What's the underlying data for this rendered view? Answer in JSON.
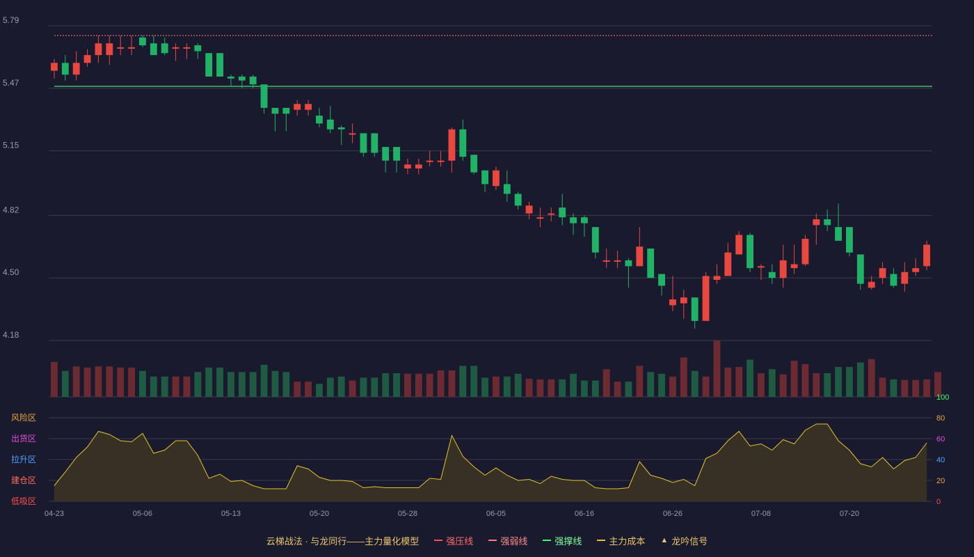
{
  "colors": {
    "background": "#1a1a2e",
    "up": "#e8483f",
    "down": "#20b267",
    "up_volume": "#6b2b30",
    "down_volume": "#1f5a43",
    "grid": "#3a3a4e",
    "axis_text": "#9a9aa8",
    "resistance": "#ff7a7a",
    "support": "#3dbf6a",
    "indicator": "#e8c228",
    "indicator_fill": "#3b3425"
  },
  "chart_data": {
    "type": "candlestick",
    "price_axis": {
      "ticks": [
        "5.79",
        "5.47",
        "5.15",
        "4.82",
        "4.50",
        "4.18"
      ],
      "ylim": [
        4.18,
        5.79
      ]
    },
    "x_ticks": [
      "04-23",
      "05-06",
      "05-13",
      "05-20",
      "05-28",
      "06-05",
      "06-16",
      "06-26",
      "07-08",
      "07-20"
    ],
    "x_tick_indices": [
      0,
      8,
      16,
      24,
      32,
      40,
      48,
      56,
      64,
      72
    ],
    "resistance_line": 5.74,
    "support_line": 5.48,
    "candles": [
      [
        5.56,
        5.6,
        5.62,
        5.52
      ],
      [
        5.6,
        5.54,
        5.64,
        5.51
      ],
      [
        5.54,
        5.6,
        5.66,
        5.51
      ],
      [
        5.6,
        5.64,
        5.67,
        5.58
      ],
      [
        5.64,
        5.7,
        5.74,
        5.6
      ],
      [
        5.64,
        5.7,
        5.74,
        5.59
      ],
      [
        5.68,
        5.68,
        5.74,
        5.64
      ],
      [
        5.68,
        5.68,
        5.74,
        5.64
      ],
      [
        5.73,
        5.69,
        5.74,
        5.68
      ],
      [
        5.7,
        5.64,
        5.74,
        5.64
      ],
      [
        5.7,
        5.65,
        5.73,
        5.64
      ],
      [
        5.68,
        5.68,
        5.7,
        5.61
      ],
      [
        5.68,
        5.68,
        5.7,
        5.62
      ],
      [
        5.69,
        5.66,
        5.7,
        5.62
      ],
      [
        5.65,
        5.53,
        5.65,
        5.53
      ],
      [
        5.65,
        5.53,
        5.65,
        5.53
      ],
      [
        5.53,
        5.52,
        5.54,
        5.48
      ],
      [
        5.53,
        5.51,
        5.54,
        5.47
      ],
      [
        5.53,
        5.49,
        5.54,
        5.47
      ],
      [
        5.49,
        5.37,
        5.49,
        5.34
      ],
      [
        5.37,
        5.34,
        5.37,
        5.25
      ],
      [
        5.37,
        5.34,
        5.37,
        5.25
      ],
      [
        5.36,
        5.39,
        5.41,
        5.33
      ],
      [
        5.36,
        5.39,
        5.41,
        5.33
      ],
      [
        5.33,
        5.29,
        5.37,
        5.27
      ],
      [
        5.31,
        5.26,
        5.38,
        5.24
      ],
      [
        5.27,
        5.26,
        5.28,
        5.18
      ],
      [
        5.24,
        5.24,
        5.29,
        5.19
      ],
      [
        5.24,
        5.14,
        5.24,
        5.12
      ],
      [
        5.24,
        5.14,
        5.24,
        5.12
      ],
      [
        5.17,
        5.1,
        5.17,
        5.04
      ],
      [
        5.17,
        5.1,
        5.17,
        5.04
      ],
      [
        5.06,
        5.08,
        5.11,
        5.03
      ],
      [
        5.06,
        5.08,
        5.11,
        5.03
      ],
      [
        5.1,
        5.1,
        5.15,
        5.07
      ],
      [
        5.1,
        5.1,
        5.15,
        5.07
      ],
      [
        5.1,
        5.26,
        5.27,
        5.04
      ],
      [
        5.26,
        5.12,
        5.31,
        5.1
      ],
      [
        5.13,
        5.04,
        5.13,
        5.03
      ],
      [
        5.05,
        4.98,
        5.05,
        4.94
      ],
      [
        4.97,
        5.05,
        5.07,
        4.95
      ],
      [
        4.98,
        4.93,
        5.05,
        4.89
      ],
      [
        4.93,
        4.87,
        4.94,
        4.85
      ],
      [
        4.83,
        4.87,
        4.89,
        4.8
      ],
      [
        4.81,
        4.81,
        4.86,
        4.76
      ],
      [
        4.83,
        4.83,
        4.86,
        4.79
      ],
      [
        4.86,
        4.81,
        4.93,
        4.77
      ],
      [
        4.81,
        4.78,
        4.83,
        4.72
      ],
      [
        4.81,
        4.78,
        4.82,
        4.71
      ],
      [
        4.76,
        4.63,
        4.76,
        4.6
      ],
      [
        4.59,
        4.59,
        4.65,
        4.55
      ],
      [
        4.59,
        4.59,
        4.64,
        4.55
      ],
      [
        4.59,
        4.56,
        4.6,
        4.45
      ],
      [
        4.56,
        4.66,
        4.76,
        4.56
      ],
      [
        4.65,
        4.5,
        4.65,
        4.5
      ],
      [
        4.52,
        4.46,
        4.52,
        4.41
      ],
      [
        4.36,
        4.39,
        4.51,
        4.33
      ],
      [
        4.37,
        4.4,
        4.44,
        4.29
      ],
      [
        4.4,
        4.28,
        4.4,
        4.24
      ],
      [
        4.28,
        4.51,
        4.53,
        4.28
      ],
      [
        4.49,
        4.51,
        4.57,
        4.47
      ],
      [
        4.51,
        4.63,
        4.68,
        4.51
      ],
      [
        4.62,
        4.72,
        4.74,
        4.62
      ],
      [
        4.72,
        4.55,
        4.73,
        4.53
      ],
      [
        4.56,
        4.56,
        4.57,
        4.49
      ],
      [
        4.53,
        4.5,
        4.57,
        4.47
      ],
      [
        4.5,
        4.59,
        4.67,
        4.45
      ],
      [
        4.55,
        4.57,
        4.67,
        4.52
      ],
      [
        4.57,
        4.7,
        4.72,
        4.56
      ],
      [
        4.77,
        4.8,
        4.83,
        4.67
      ],
      [
        4.8,
        4.77,
        4.85,
        4.74
      ],
      [
        4.76,
        4.69,
        4.88,
        4.69
      ],
      [
        4.76,
        4.63,
        4.76,
        4.61
      ],
      [
        4.62,
        4.47,
        4.62,
        4.44
      ],
      [
        4.45,
        4.48,
        4.51,
        4.44
      ],
      [
        4.5,
        4.55,
        4.58,
        4.47
      ],
      [
        4.52,
        4.46,
        4.55,
        4.45
      ],
      [
        4.47,
        4.53,
        4.58,
        4.43
      ],
      [
        4.53,
        4.55,
        4.6,
        4.51
      ],
      [
        4.56,
        4.67,
        4.69,
        4.54
      ]
    ],
    "volume_heights": [
      0.62,
      0.46,
      0.54,
      0.52,
      0.54,
      0.54,
      0.52,
      0.52,
      0.46,
      0.36,
      0.36,
      0.36,
      0.36,
      0.44,
      0.52,
      0.52,
      0.44,
      0.44,
      0.44,
      0.57,
      0.46,
      0.44,
      0.27,
      0.27,
      0.23,
      0.34,
      0.36,
      0.29,
      0.34,
      0.34,
      0.42,
      0.42,
      0.41,
      0.41,
      0.41,
      0.47,
      0.47,
      0.55,
      0.55,
      0.34,
      0.36,
      0.36,
      0.41,
      0.32,
      0.31,
      0.31,
      0.31,
      0.41,
      0.29,
      0.29,
      0.49,
      0.27,
      0.27,
      0.55,
      0.44,
      0.41,
      0.36,
      0.7,
      0.46,
      0.36,
      1.0,
      0.52,
      0.53,
      0.66,
      0.42,
      0.49,
      0.4,
      0.64,
      0.58,
      0.42,
      0.42,
      0.53,
      0.53,
      0.61,
      0.67,
      0.34,
      0.31,
      0.3,
      0.3,
      0.31,
      0.44
    ],
    "indicator": {
      "axis_values": [
        "0",
        "20",
        "40",
        "60",
        "80",
        "100"
      ],
      "axis_colors": [
        "#ff4d4d",
        "#ff9c3a",
        "#4aa3ff",
        "#e04fd6",
        "#e8a43a",
        "#3dff6a"
      ],
      "zones": [
        {
          "label": "风险区",
          "color": "#e8a43a"
        },
        {
          "label": "出货区",
          "color": "#e04fd6"
        },
        {
          "label": "拉升区",
          "color": "#4aa3ff"
        },
        {
          "label": "建仓区",
          "color": "#ff6b5a"
        },
        {
          "label": "低吸区",
          "color": "#ff4d4d"
        }
      ],
      "values": [
        15,
        28,
        42,
        52,
        67,
        64,
        58,
        57,
        65,
        46,
        49,
        58,
        58,
        44,
        22,
        26,
        19,
        20,
        15,
        12,
        12,
        12,
        34,
        31,
        23,
        20,
        20,
        19,
        13,
        14,
        13,
        13,
        13,
        13,
        22,
        21,
        63,
        43,
        33,
        25,
        32,
        25,
        20,
        21,
        17,
        24,
        21,
        20,
        20,
        13,
        12,
        12,
        13,
        38,
        25,
        22,
        18,
        21,
        15,
        41,
        46,
        58,
        67,
        53,
        55,
        49,
        59,
        55,
        68,
        74,
        74,
        58,
        49,
        36,
        33,
        42,
        31,
        39,
        42,
        56
      ]
    }
  },
  "legend": {
    "title": "云梯战法 · 与龙同行——主力量化模型",
    "items": [
      {
        "label": "强压线",
        "color": "#ff4d4d",
        "style": "solid"
      },
      {
        "label": "强弱线",
        "color": "#ff7a7a",
        "style": "dashed"
      },
      {
        "label": "强撑线",
        "color": "#3dff6a",
        "style": "solid"
      },
      {
        "label": "主力成本",
        "color": "#e8c228",
        "style": "dashed"
      },
      {
        "label": "龙吟信号",
        "color": "#e8c228",
        "style": "triangle"
      }
    ]
  }
}
